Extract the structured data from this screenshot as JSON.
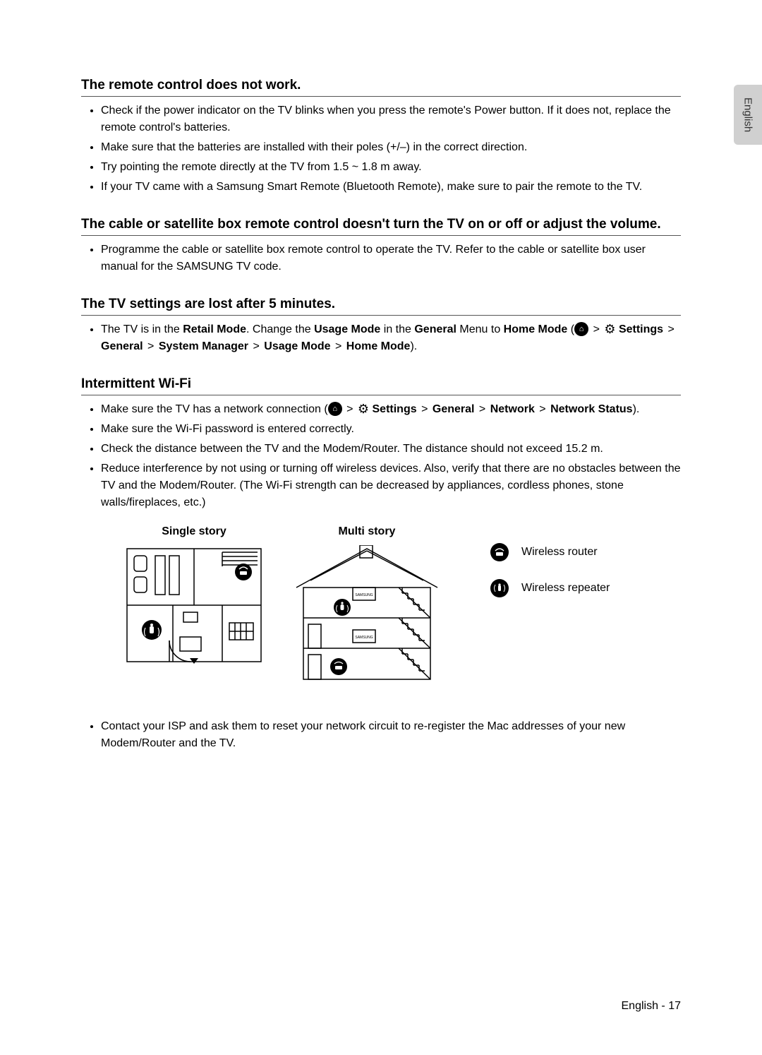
{
  "sideTab": "English",
  "sections": {
    "s1": {
      "title": "The remote control does not work.",
      "b1": "Check if the power indicator on the TV blinks when you press the remote's Power button. If it does not, replace the remote control's batteries.",
      "b2": "Make sure that the batteries are installed with their poles (+/–) in the correct direction.",
      "b3": "Try pointing the remote directly at the TV from 1.5 ~ 1.8 m away.",
      "b4": "If your TV came with a Samsung Smart Remote (Bluetooth Remote), make sure to pair the remote to the TV."
    },
    "s2": {
      "title": "The cable or satellite box remote control doesn't turn the TV on or off or adjust the volume.",
      "b1": "Programme the cable or satellite box remote control to operate the TV. Refer to the cable or satellite box user manual for the SAMSUNG TV code."
    },
    "s3": {
      "title": "The TV settings are lost after 5 minutes.",
      "b1_pre": "The TV is in the ",
      "b1_retail": "Retail Mode",
      "b1_mid1": ". Change the ",
      "b1_usage": "Usage Mode",
      "b1_mid2": " in the ",
      "b1_general": "General",
      "b1_mid3": " Menu to ",
      "b1_home": "Home Mode",
      "b1_open": " (",
      "nav_settings": "Settings",
      "nav_general": "General",
      "nav_sysmgr": "System Manager",
      "nav_usage": "Usage Mode",
      "nav_home": "Home Mode",
      "b1_close": ")."
    },
    "s4": {
      "title": "Intermittent Wi-Fi",
      "b1_pre": "Make sure the TV has a network connection (",
      "nav_settings": "Settings",
      "nav_general": "General",
      "nav_network": "Network",
      "nav_status": "Network Status",
      "b1_close": ").",
      "b2": "Make sure the Wi-Fi password is entered correctly.",
      "b3": "Check the distance between the TV and the Modem/Router. The distance should not exceed 15.2 m.",
      "b4": "Reduce interference by not using or turning off wireless devices. Also, verify that there are no obstacles between the TV and the Modem/Router. (The Wi-Fi strength can be decreased by appliances, cordless phones, stone walls/fireplaces, etc.)",
      "b5": "Contact your ISP and ask them to reset your network circuit to re-register the Mac addresses of your new Modem/Router and the TV."
    }
  },
  "diagrams": {
    "single": "Single story",
    "multi": "Multi story",
    "legend_router": "Wireless router",
    "legend_repeater": "Wireless repeater"
  },
  "footer": "English - 17",
  "arrow": ">"
}
